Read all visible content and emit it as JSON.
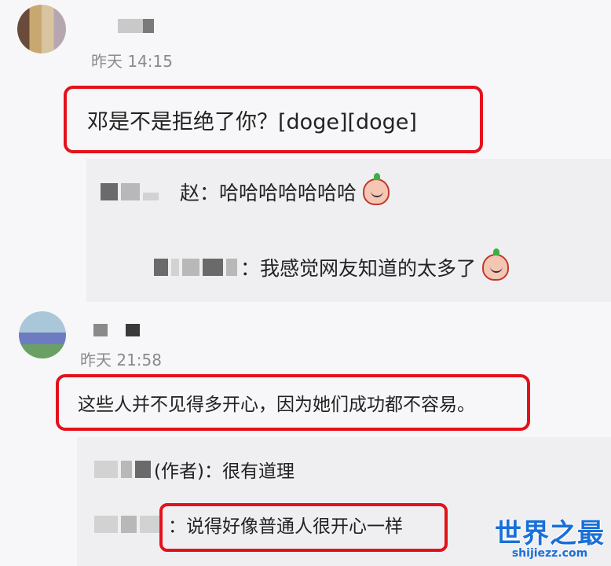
{
  "comments": [
    {
      "time": "昨天 14:15",
      "text": "邓是不是拒绝了你？[doge][doge]",
      "replies": [
        {
          "name_suffix": "ﾠ赵",
          "text": "：哈哈哈哈哈哈哈",
          "emoji": "peach-laugh-emoji"
        },
        {
          "name_suffix": "",
          "text": "：我感觉网友知道的太多了",
          "emoji": "peach-laugh-emoji"
        }
      ]
    },
    {
      "time": "昨天 21:58",
      "text": "这些人并不见得多开心，因为她们成功都不容易。",
      "replies": [
        {
          "name_suffix": "(作者)",
          "text": "：很有道理"
        },
        {
          "name_suffix": "",
          "text": "：说得好像普通人很开心一样"
        }
      ]
    }
  ],
  "watermark": {
    "title": "世界之最",
    "url": "shijiezz.com"
  },
  "colors": {
    "highlight": "#e4111b",
    "watermark": "#1a6fd8"
  }
}
